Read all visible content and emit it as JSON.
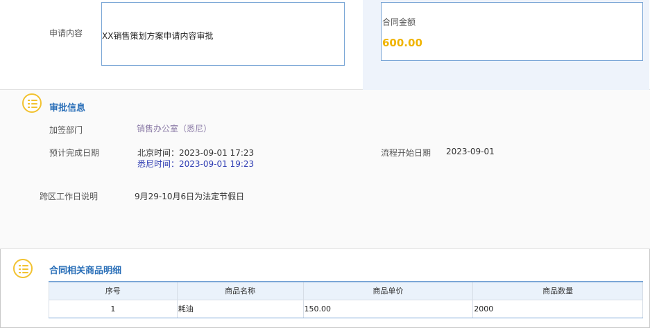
{
  "top": {
    "apply_label": "申请内容",
    "apply_content": "XX销售策划方案申请内容审批",
    "amount_label": "合同金额",
    "amount_value": "600.00"
  },
  "approval": {
    "title": "审批信息",
    "countersign_dept_label": "加签部门",
    "countersign_dept_value": "销售办公室（悉尼）",
    "expected_date_label": "预计完成日期",
    "beijing_time": "北京时间：2023-09-01 17:23",
    "sydney_time": "悉尼时间：2023-09-01 19:23",
    "flow_start_label": "流程开始日期",
    "flow_start_value": "2023-09-01",
    "cross_region_label": "跨区工作日说明",
    "cross_region_value": "9月29-10月6日为法定节假日"
  },
  "products": {
    "title": "合同相关商品明细",
    "columns": [
      "序号",
      "商品名称",
      "商品单价",
      "商品数量"
    ],
    "rows": [
      [
        "1",
        "耗油",
        "150.00",
        "2000"
      ]
    ]
  },
  "colors": {
    "accent_blue": "#2a6fb8",
    "amount_gold": "#f0b400",
    "icon_yellow": "#f2c230"
  }
}
